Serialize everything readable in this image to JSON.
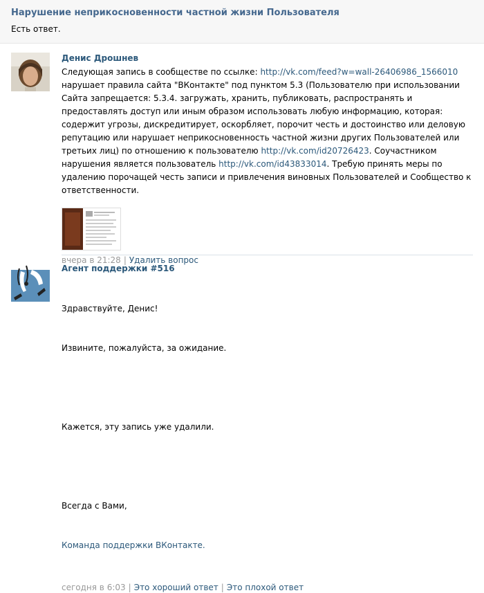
{
  "ticket": {
    "title": "Нарушение неприкосновенности частной жизни Пользователя",
    "status": "Есть ответ."
  },
  "question": {
    "author": "Денис Дрошнев",
    "text_parts": {
      "p1": "Следующая запись в сообществе по ссылке: ",
      "link1": "http://vk.com/feed?w=wall-26406986_1566010",
      "p2": " нарушает правила сайта \"ВКонтакте\" под пунктом 5.3 (Пользователю при использовании Сайта запрещается: 5.3.4. загружать, хранить, публиковать, распространять и предоставлять доступ или иным образом использовать любую информацию, которая:\nсодержит угрозы, дискредитирует, оскорбляет, порочит честь и достоинство или деловую репутацию или нарушает неприкосновенность частной жизни других Пользователей или третьих лиц) по отношению к пользователю ",
      "link2": "http://vk.com/id20726423",
      "p3": ". Соучастником нарушения является пользователь ",
      "link3": "http://vk.com/id43833014",
      "p4": ". Требую принять меры по удалению порочащей честь записи и привлечения виновных Пользователей и Сообщество к ответственности."
    },
    "time": "вчера в 21:28",
    "separator": "|",
    "delete_label": "Удалить вопрос"
  },
  "answer": {
    "author": "Агент поддержки #516",
    "lines": {
      "l1": "Здравствуйте, Денис!",
      "l2": "Извините, пожалуйста, за ожидание.",
      "l3": "Кажется, эту запись уже удалили.",
      "l4": "Всегда с Вами,",
      "signature": "Команда поддержки ВКонтакте."
    },
    "time": "сегодня в 6:03",
    "separator": "|",
    "good_label": "Это хороший ответ",
    "bad_label": "Это плохой ответ"
  },
  "colors": {
    "link": "#2b587a",
    "title": "#45688e",
    "meta": "#999999"
  }
}
